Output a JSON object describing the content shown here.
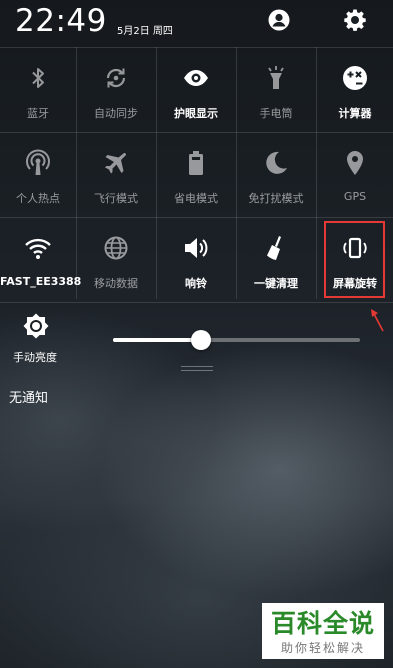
{
  "status_bar": {
    "time": "22:49",
    "date": "5月2日 周四",
    "icons": [
      "user-icon",
      "settings-gear-icon"
    ]
  },
  "quick_settings": {
    "rows": [
      [
        {
          "label": "蓝牙",
          "icon": "bluetooth-icon",
          "active": false
        },
        {
          "label": "自动同步",
          "icon": "sync-icon",
          "active": false
        },
        {
          "label": "护眼显示",
          "icon": "eye-icon",
          "active": true
        },
        {
          "label": "手电筒",
          "icon": "flashlight-icon",
          "active": false
        },
        {
          "label": "计算器",
          "icon": "calculator-icon",
          "active": true
        }
      ],
      [
        {
          "label": "个人热点",
          "icon": "hotspot-icon",
          "active": false
        },
        {
          "label": "飞行模式",
          "icon": "airplane-icon",
          "active": false
        },
        {
          "label": "省电模式",
          "icon": "battery-icon",
          "active": false
        },
        {
          "label": "免打扰模式",
          "icon": "moon-icon",
          "active": false
        },
        {
          "label": "GPS",
          "icon": "location-pin-icon",
          "active": false
        }
      ],
      [
        {
          "label": "FAST_EE3388",
          "icon": "wifi-icon",
          "active": true
        },
        {
          "label": "移动数据",
          "icon": "globe-icon",
          "active": false
        },
        {
          "label": "响铃",
          "icon": "speaker-icon",
          "active": true
        },
        {
          "label": "一键清理",
          "icon": "broom-icon",
          "active": true
        },
        {
          "label": "屏幕旋转",
          "icon": "screen-rotate-icon",
          "active": true
        }
      ]
    ]
  },
  "brightness": {
    "label": "手动亮度",
    "icon": "brightness-icon",
    "level_fraction": 0.355
  },
  "notifications": {
    "empty_text": "无通知"
  },
  "annotation": {
    "highlight_color": "#e53935"
  },
  "watermark": {
    "title": "百科全说",
    "subtitle": "助你轻松解决"
  }
}
